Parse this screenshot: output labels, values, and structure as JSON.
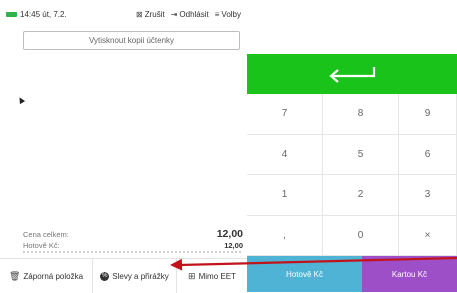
{
  "status": {
    "time": "14:45 út, 7.2."
  },
  "toolbar": {
    "cancel_label": "Zrušit",
    "logout_label": "Odhlásit",
    "options_label": "Volby"
  },
  "receipt": {
    "print_copy_label": "Vytisknout kopii účtenky"
  },
  "totals": {
    "total_label": "Cena celkem:",
    "total_value": "12,00",
    "cash_label": "Hotově Kč:",
    "cash_value": "12,00"
  },
  "bottom": {
    "negative_item": "Záporná položka",
    "discounts": "Slevy a přirážky",
    "outside_eet": "Mimo EET"
  },
  "keypad": {
    "rows": [
      [
        "7",
        "8",
        "9"
      ],
      [
        "4",
        "5",
        "6"
      ],
      [
        "1",
        "2",
        "3"
      ],
      [
        ",",
        "0",
        "×"
      ]
    ]
  },
  "payment": {
    "cash_label": "Hotově Kč",
    "card_label": "Kartou Kč"
  },
  "colors": {
    "enter": "#19c31a",
    "cash": "#4fb3d6",
    "card": "#9c4fc6",
    "annotation_arrow": "#c0141c",
    "battery": "#2db34a"
  },
  "icons": [
    "battery-icon",
    "cancel-icon",
    "logout-icon",
    "menu-icon",
    "enter-arrow-icon",
    "trash-icon",
    "discount-icon",
    "no-eet-icon"
  ]
}
